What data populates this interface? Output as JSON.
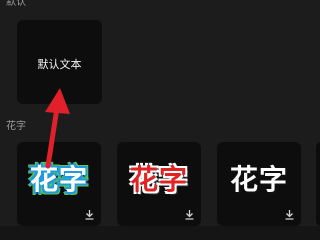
{
  "sections": {
    "default_label": "默认",
    "fancy_label": "花字"
  },
  "tiles": {
    "default_text": "默认文本",
    "fancy": [
      {
        "text": "花字",
        "style": "blue-green outline"
      },
      {
        "text": "花字",
        "style": "red with white outline"
      },
      {
        "text": "花字",
        "style": "white with dark shadow"
      }
    ]
  },
  "icons": {
    "download": "download-icon",
    "arrow": "red-arrow-annotation"
  },
  "colors": {
    "background": "#1c1c1d",
    "tile": "#0d0d0e",
    "annotation_arrow": "#e0202a"
  }
}
